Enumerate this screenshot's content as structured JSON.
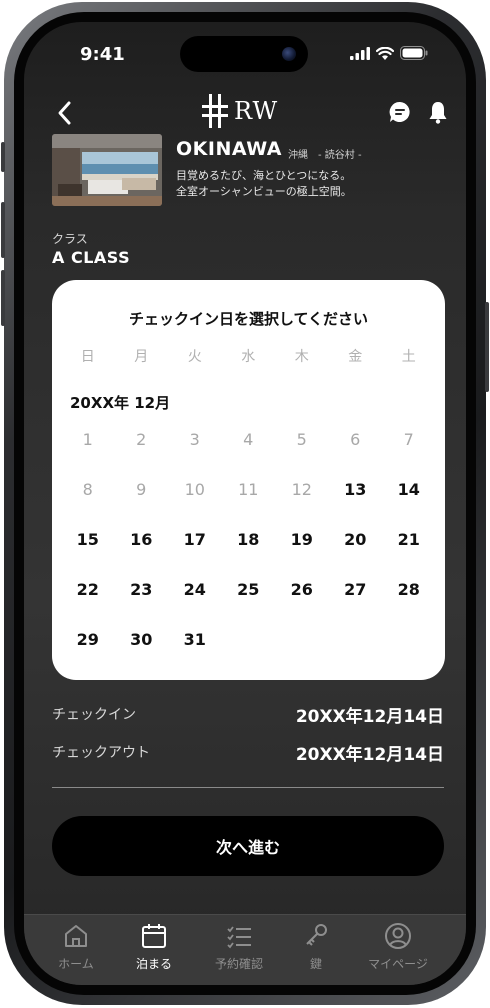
{
  "status_bar": {
    "time": "9:41"
  },
  "header": {
    "logo_text": "RW"
  },
  "hotel": {
    "name": "OKINAWA",
    "location": "沖縄　- 読谷村 -",
    "description_line1": "目覚めるたび、海とひとつになる。",
    "description_line2": "全室オーシャンビューの極上空間。"
  },
  "room_class": {
    "label": "クラス",
    "value": "A CLASS"
  },
  "calendar": {
    "title": "チェックイン日を選択してください",
    "weekdays": [
      "日",
      "月",
      "火",
      "水",
      "木",
      "金",
      "土"
    ],
    "month_label": "20XX年 12月",
    "first_available_day": 13,
    "days": [
      "1",
      "2",
      "3",
      "4",
      "5",
      "6",
      "7",
      "8",
      "9",
      "10",
      "11",
      "12",
      "13",
      "14",
      "15",
      "16",
      "17",
      "18",
      "19",
      "20",
      "21",
      "22",
      "23",
      "24",
      "25",
      "26",
      "27",
      "28",
      "29",
      "30",
      "31"
    ]
  },
  "summary": {
    "checkin_label": "チェックイン",
    "checkin_value": "20XX年12月14日",
    "checkout_label": "チェックアウト",
    "checkout_value": "20XX年12月14日"
  },
  "next_button": {
    "label": "次へ進む"
  },
  "tab_bar": {
    "tabs": [
      {
        "label": "ホーム",
        "icon": "home-icon",
        "active": false
      },
      {
        "label": "泊まる",
        "icon": "calendar-icon",
        "active": true
      },
      {
        "label": "予約確認",
        "icon": "checklist-icon",
        "active": false
      },
      {
        "label": "鍵",
        "icon": "key-icon",
        "active": false
      },
      {
        "label": "マイページ",
        "icon": "user-icon",
        "active": false
      }
    ]
  },
  "colors": {
    "screen_background": "#2a2a2a",
    "calendar_background": "#ffffff",
    "disabled_day": "#a8a8a8",
    "button_background": "#000000",
    "tab_inactive": "#8e8e8e",
    "tab_active": "#ffffff"
  }
}
